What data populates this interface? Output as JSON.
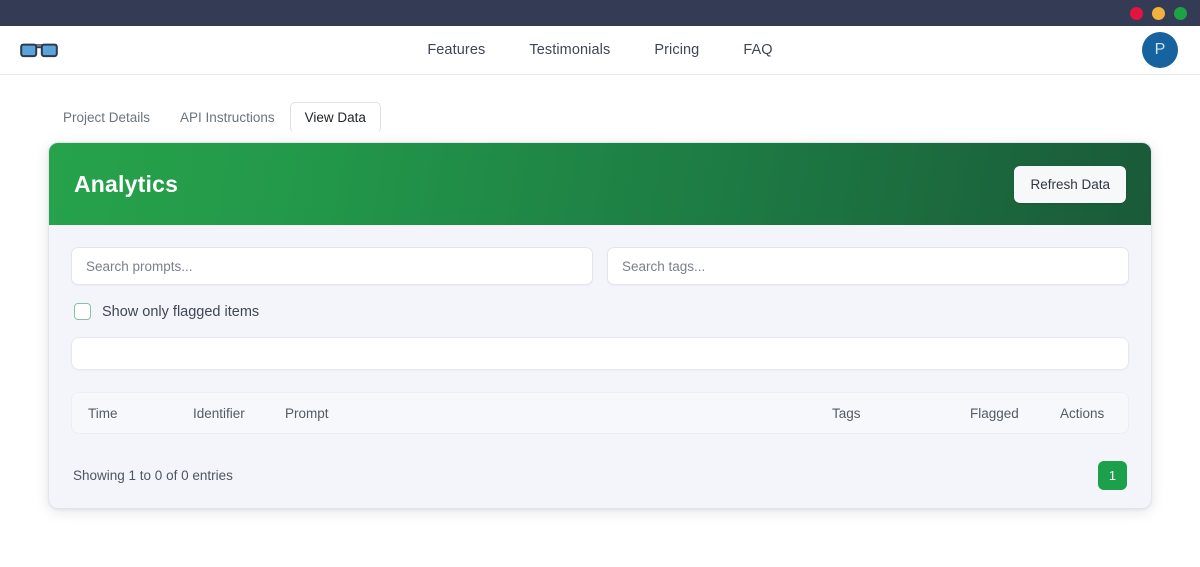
{
  "window": {
    "controls": [
      {
        "name": "close",
        "color": "#e31440"
      },
      {
        "name": "minimize",
        "color": "#f2b03e"
      },
      {
        "name": "maximize",
        "color": "#1ba345"
      }
    ]
  },
  "navbar": {
    "logo_icon": "sunglasses-icon",
    "links": [
      {
        "label": "Features"
      },
      {
        "label": "Testimonials"
      },
      {
        "label": "Pricing"
      },
      {
        "label": "FAQ"
      }
    ],
    "avatar": {
      "initial": "P",
      "color": "#16639f"
    }
  },
  "tabs": [
    {
      "label": "Project Details",
      "active": false
    },
    {
      "label": "API Instructions",
      "active": false
    },
    {
      "label": "View Data",
      "active": true
    }
  ],
  "card": {
    "title": "Analytics",
    "header_gradient_from": "#27a24b",
    "header_gradient_to": "#1a5a39",
    "refresh_label": "Refresh Data"
  },
  "filters": {
    "prompt_search": {
      "value": "",
      "placeholder": "Search prompts..."
    },
    "tag_search": {
      "value": "",
      "placeholder": "Search tags..."
    },
    "flagged_checkbox": {
      "label": "Show only flagged items",
      "checked": false
    },
    "tag_bar": {
      "value": ""
    }
  },
  "table": {
    "columns": [
      {
        "key": "time",
        "label": "Time"
      },
      {
        "key": "identifier",
        "label": "Identifier"
      },
      {
        "key": "prompt",
        "label": "Prompt"
      },
      {
        "key": "tags",
        "label": "Tags"
      },
      {
        "key": "flagged",
        "label": "Flagged"
      },
      {
        "key": "actions",
        "label": "Actions"
      }
    ],
    "rows": [],
    "entries_text": "Showing 1 to 0 of 0 entries",
    "pagination": {
      "current_page": "1",
      "accent": "#1da04b"
    }
  }
}
